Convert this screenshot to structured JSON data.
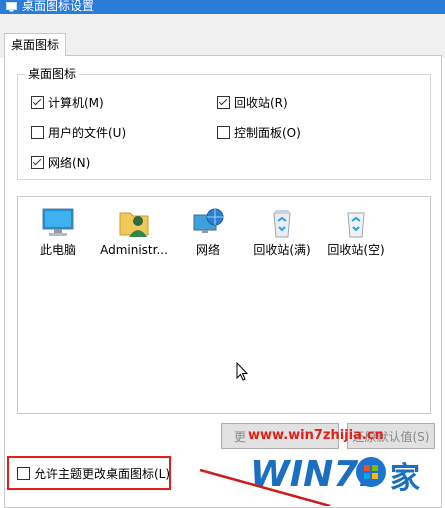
{
  "window": {
    "title": "桌面图标设置"
  },
  "tabs": [
    {
      "label": "桌面图标"
    }
  ],
  "desktop_icons_group": {
    "legend": "桌面图标",
    "checkboxes": [
      {
        "label": "计算机(M)",
        "checked": true
      },
      {
        "label": "回收站(R)",
        "checked": true
      },
      {
        "label": "用户的文件(U)",
        "checked": false
      },
      {
        "label": "控制面板(O)",
        "checked": false
      },
      {
        "label": "网络(N)",
        "checked": true
      }
    ]
  },
  "icon_list": [
    {
      "label": "此电脑",
      "icon": "computer-icon"
    },
    {
      "label": "Administr...",
      "icon": "user-folder-icon"
    },
    {
      "label": "网络",
      "icon": "network-icon"
    },
    {
      "label": "回收站(满)",
      "icon": "recycle-bin-full-icon"
    },
    {
      "label": "回收站(空)",
      "icon": "recycle-bin-empty-icon"
    }
  ],
  "buttons": {
    "change_icon": "更",
    "restore_default": "还原默认值(S)"
  },
  "allow_themes": {
    "label": "允许主题更改桌面图标(L)",
    "checked": false
  },
  "watermark": {
    "url": "www.win7zhijia.cn",
    "logo_text": "WIN7.家"
  },
  "colors": {
    "titlebar": "#2b7bd8",
    "highlight": "#e0201a"
  }
}
